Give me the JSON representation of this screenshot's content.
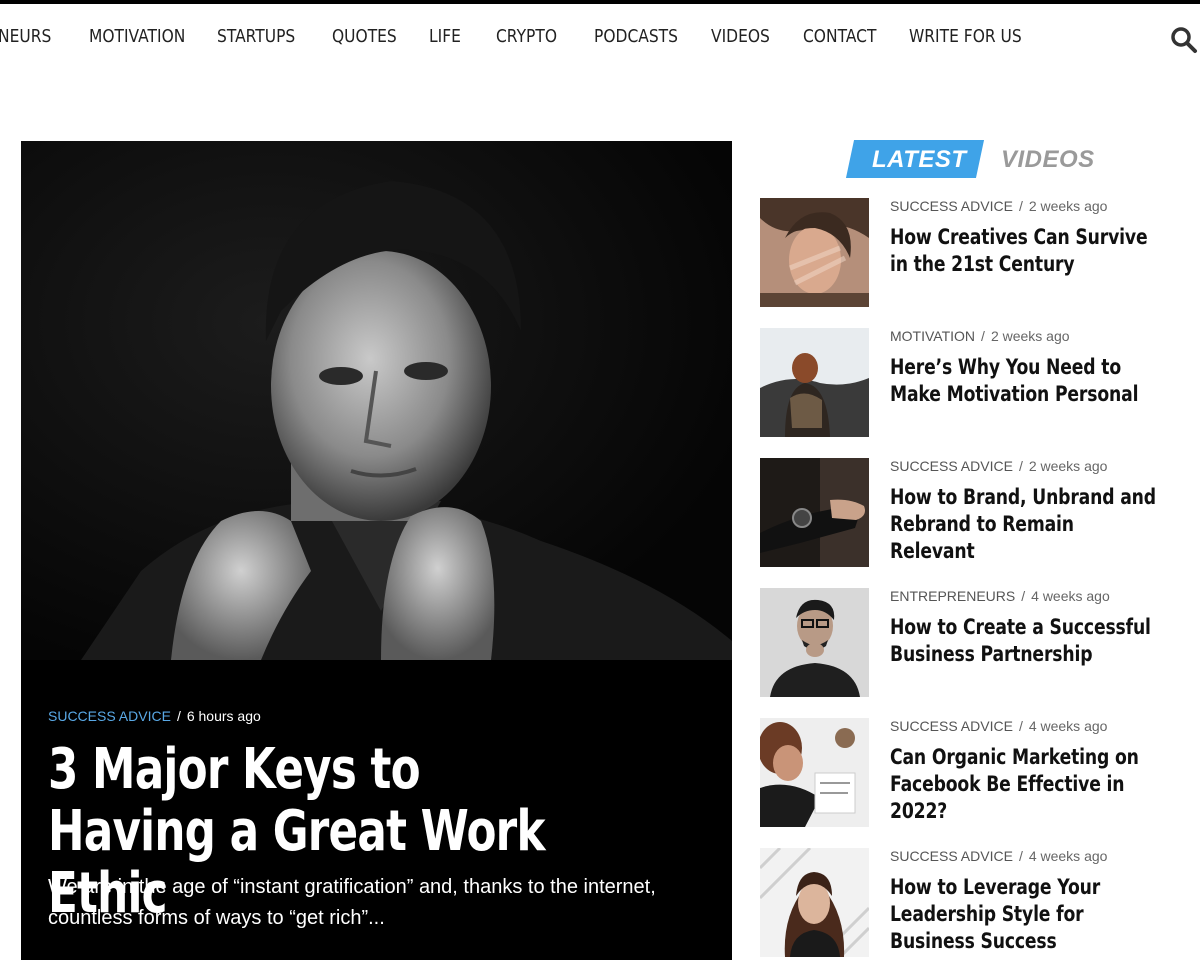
{
  "nav": {
    "items": [
      "NEURS",
      "MOTIVATION",
      "STARTUPS",
      "QUOTES",
      "LIFE",
      "CRYPTO",
      "PODCASTS",
      "VIDEOS",
      "CONTACT",
      "WRITE FOR US"
    ]
  },
  "hero": {
    "category": "SUCCESS ADVICE",
    "separator": "/",
    "time": "6 hours ago",
    "title": "3 Major Keys to Having a Great Work Ethic",
    "excerpt": "We are in the age of “instant gratification” and, thanks to the internet, countless forms of ways to “get rich”..."
  },
  "tabs": {
    "latest": "LATEST",
    "videos": "VIDEOS"
  },
  "feed": [
    {
      "category": "SUCCESS ADVICE",
      "time": "2 weeks ago",
      "title": "How Creatives Can Survive in the 21st Century"
    },
    {
      "category": "MOTIVATION",
      "time": "2 weeks ago",
      "title": "Here’s Why You Need to Make Motivation Personal"
    },
    {
      "category": "SUCCESS ADVICE",
      "time": "2 weeks ago",
      "title": "How to Brand, Unbrand and Rebrand to Remain Relevant"
    },
    {
      "category": "ENTREPRENEURS",
      "time": "4 weeks ago",
      "title": "How to Create a Successful Business Partnership"
    },
    {
      "category": "SUCCESS ADVICE",
      "time": "4 weeks ago",
      "title": "Can Organic Marketing on Facebook Be Effective in 2022?"
    },
    {
      "category": "SUCCESS ADVICE",
      "time": "4 weeks ago",
      "title": "How to Leverage Your Leadership Style for Business Success"
    }
  ],
  "colors": {
    "accent": "#3fa3e8",
    "hero_category": "#5aa9e6"
  }
}
